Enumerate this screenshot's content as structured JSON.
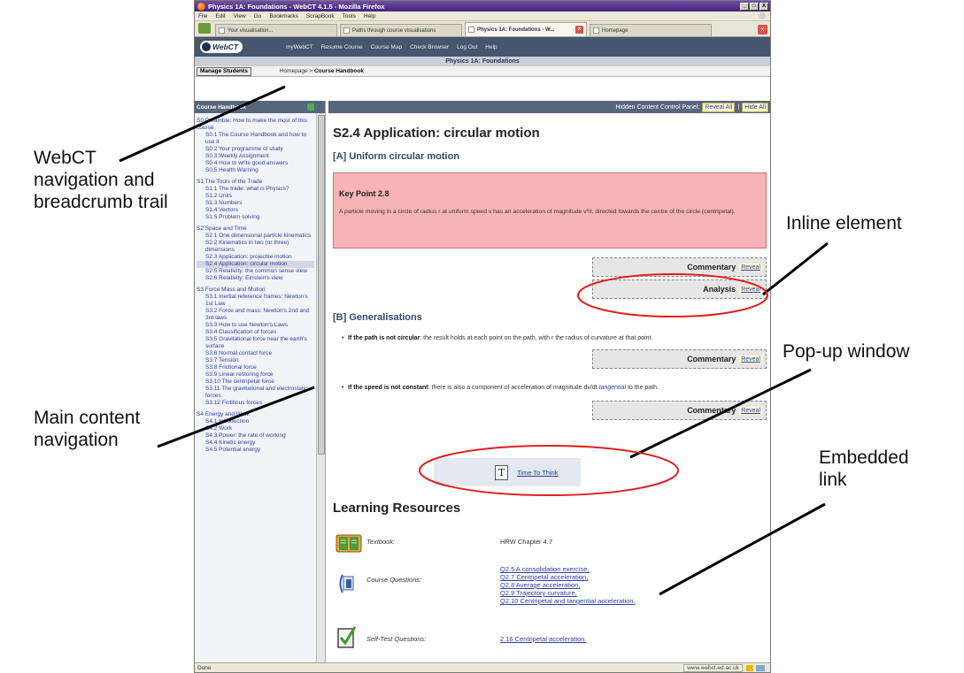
{
  "browser": {
    "window_title": "Physics 1A: Foundations - WebCT 4.1.5 - Mozilla Firefox",
    "window_buttons": [
      "_",
      "□",
      "X"
    ],
    "menus": [
      "File",
      "Edit",
      "View",
      "Go",
      "Bookmarks",
      "ScrapBook",
      "Tools",
      "Help"
    ],
    "tabs": [
      {
        "label": "Your visualisation...",
        "active": false
      },
      {
        "label": "Paths through course visualisations",
        "active": false
      },
      {
        "label": "Physics 1A: Foundations - W...",
        "active": true
      },
      {
        "label": "Homepage",
        "active": false
      }
    ],
    "tab_close_glyph": "x"
  },
  "webct": {
    "logo_text": "WebCT",
    "nav_links": [
      "myWebCT",
      "Resume Course",
      "Course Map",
      "Check Browser",
      "Log Out",
      "Help"
    ],
    "course_title": "Physics 1A: Foundations",
    "manage_students_label": "Manage Students",
    "breadcrumb_home": "Homepage",
    "breadcrumb_sep": " > ",
    "breadcrumb_current": "Course Handbook"
  },
  "left_nav": {
    "heading": "Course Handbook",
    "sections": [
      {
        "title": "S0 Preamble: How to make the most of this course",
        "items": [
          "S0.1 The Course Handbook and how to use it",
          "S0.2 Your programme of study",
          "S0.3 Weekly Assignment",
          "S0.4 How to write good answers",
          "S0.5 Health Warning"
        ]
      },
      {
        "title": "S1 The Tools of the Trade",
        "items": [
          "S1.1 The trade: what is Physics?",
          "S1.2 Units",
          "S1.3 Numbers",
          "S1.4 Vectors",
          "S1.5 Problem solving"
        ]
      },
      {
        "title": "S2 Space and Time",
        "items": [
          "S2.1 One dimensional particle kinematics",
          "S2.2 Kinematics in two (or three) dimensions",
          "S2.3 Application: projectile motion",
          "S2.4 Application: circular motion",
          "S2.5 Relativity: the common sense view",
          "S2.6 Relativity: Einstein's view"
        ]
      },
      {
        "title": "S3 Force Mass and Motion",
        "items": [
          "S3.1 Inertial reference frames: Newton's 1st Law",
          "S3.2 Force and mass: Newton's 2nd and 3rd laws",
          "S3.3 How to use Newton's Laws",
          "S3.4 Classification of forces",
          "S3.5 Gravitational force near the earth's surface",
          "S3.6 Normal contact force",
          "S3.7 Tension",
          "S3.8 Frictional force",
          "S3.9 Linear restoring force",
          "S3.10 The centripetal force",
          "S3.11 The gravitational and electrostatic forces",
          "S3.12 Fictitious forces"
        ]
      },
      {
        "title": "S4 Energy and Work",
        "items": [
          "S4.1 Introduction",
          "S4.2 Work",
          "S4.3 Power: the rate of working",
          "S4.4 Kinetic energy",
          "S4.5 Potential energy"
        ]
      }
    ],
    "active_item": "S2.4 Application: circular motion"
  },
  "content": {
    "hcp_label": "Hidden Content Control Panel:",
    "reveal_all": "Reveal All",
    "hcp_sep": "|",
    "hide_all": "Hide All",
    "page_title": "S2.4 Application: circular motion",
    "section_a": "[A] Uniform circular motion",
    "key_point_title": "Key Point 2.8",
    "key_point_text": "A particle moving in a circle of radius r at uniform speed v has an acceleration of magnitude v²/r, directed towards the centre of the circle (centripetal).",
    "commentary_label": "Commentary",
    "analysis_label": "Analysis",
    "reveal_label": "Reveal",
    "section_b": "[B] Generalisations",
    "bullet1_bold": "If the path is not circular",
    "bullet1_text": ": the result holds at each point on the path, with r the radius of curvature at that point.",
    "bullet2_bold": "If the speed is not constant",
    "bullet2_text": ": there is also a component of acceleration of magnitude dv/dt",
    "bullet2_link": "tangential",
    "bullet2_tail": "to the path.",
    "ttt_icon_letter": "T",
    "ttt_link": "Time To Think",
    "learning_resources_title": "Learning Resources",
    "textbook_label": "Textbook:",
    "textbook_value": "HRW Chapter 4.7",
    "course_questions_label": "Course Questions:",
    "course_questions": [
      "Q2.5 A consolidation exercise,",
      "Q2.7 Centripetal acceleration,",
      "Q2.8 Average acceleration,",
      "Q2.9 Trajectory curvature,",
      "Q2.10 Centripetal and tangential acceleration."
    ],
    "self_test_label": "Self-Test Questions:",
    "self_test_link": "2.16 Centripetal acceleration."
  },
  "status_bar": {
    "status": "Done",
    "url": "www.webct.ed.ac.uk"
  },
  "annotations": {
    "webct_nav": [
      "WebCT",
      "navigation and",
      "breadcrumb trail"
    ],
    "main_nav": [
      "Main content",
      "navigation"
    ],
    "inline_element": "Inline element",
    "popup_window": "Pop-up window",
    "embedded_link": [
      "Embedded",
      "link"
    ]
  },
  "colors": {
    "webct_bar": "#46566e",
    "key_point_bg": "#f7b3b7",
    "link": "#2b3ea0",
    "highlight_ellipse": "#e02020"
  }
}
